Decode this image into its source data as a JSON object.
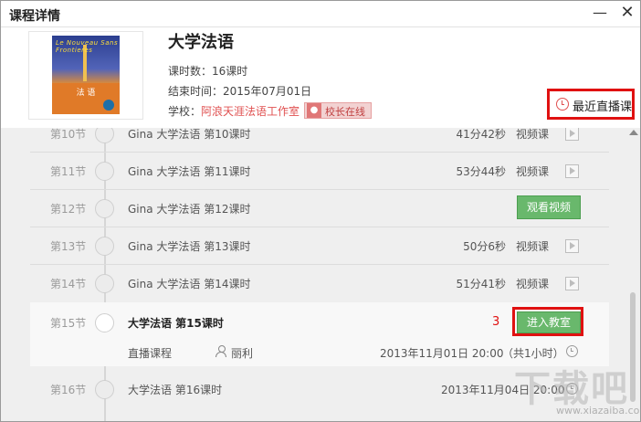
{
  "window": {
    "title": "课程详情",
    "min_glyph": "—",
    "close_glyph": "✕"
  },
  "course": {
    "cover": {
      "logo_text": "Le Nouveau Sans Frontieres",
      "book_title": "法 语"
    },
    "title": "大学法语",
    "hours_label": "课时数：",
    "hours_value": "16课时",
    "end_label": "结束时间：",
    "end_value": "2015年07月01日",
    "school_label": "学校：",
    "school_value": "阿浪天涯法语工作室",
    "principal_badge": "校长在线",
    "recent_live_button": "最近直播课"
  },
  "lessons": [
    {
      "num": "第10节",
      "title": "Gina 大学法语  第10课时",
      "duration": "41分42秒",
      "kind": "视频课"
    },
    {
      "num": "第11节",
      "title": "Gina 大学法语  第11课时",
      "duration": "53分44秒",
      "kind": "视频课"
    },
    {
      "num": "第12节",
      "title": "Gina 大学法语  第12课时",
      "button": "观看视频"
    },
    {
      "num": "第13节",
      "title": "Gina 大学法语  第13课时",
      "duration": "50分6秒",
      "kind": "视频课"
    },
    {
      "num": "第14节",
      "title": "Gina 大学法语  第14课时",
      "duration": "51分41秒",
      "kind": "视频课"
    }
  ],
  "lesson15": {
    "num": "第15节",
    "title": "大学法语 第15课时",
    "annotation": "3",
    "enter_button": "进入教室",
    "type": "直播课程",
    "teacher": "丽利",
    "datetime": "2013年11月01日  20:00",
    "duration": "（共1小时）"
  },
  "lesson16": {
    "num": "第16节",
    "title": "大学法语  第16课时",
    "datetime": "2013年11月04日  20:00"
  },
  "watermark": {
    "text": "下载吧",
    "url": "www.xiazaiba.com"
  },
  "colors": {
    "accent_red": "#e01111",
    "green_button": "#69b86c",
    "link_red": "#e05050"
  }
}
